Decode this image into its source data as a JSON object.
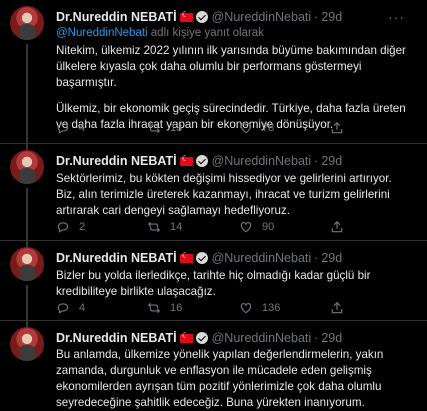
{
  "tweets": [
    {
      "name": "Dr.Nureddin NEBATİ",
      "handle": "@NureddinNebati",
      "time": "29d",
      "reply_to": "@NureddinNebati",
      "reply_suffix": " adlı kişiye yanıt olarak",
      "paragraphs": [
        "Nitekim, ülkemiz 2022 yılının ilk yarısında büyüme bakımından diğer ülkelere kıyasla çok daha olumlu bir performans göstermeyi başarmıştır.",
        "Ülkemiz, bir ekonomik geçiş sürecindedir. Türkiye, daha fazla üreten ve daha fazla ihracat yapan bir ekonomiye dönüşüyor."
      ],
      "replies": "4",
      "retweets": "13",
      "likes": "78"
    },
    {
      "name": "Dr.Nureddin NEBATİ",
      "handle": "@NureddinNebati",
      "time": "29d",
      "paragraphs": [
        "Sektörlerimiz, bu kökten değişimi hissediyor ve gelirlerini artırıyor. Biz, alın terimizle üreterek kazanmayı, ihracat ve turizm gelirlerini artırarak cari dengeyi sağlamayı hedefliyoruz."
      ],
      "replies": "2",
      "retweets": "14",
      "likes": "90"
    },
    {
      "name": "Dr.Nureddin NEBATİ",
      "handle": "@NureddinNebati",
      "time": "29d",
      "paragraphs": [
        "Bizler bu yolda ilerledikçe, tarihte hiç olmadığı kadar güçlü bir kredibiliteye birlikte ulaşacağız."
      ],
      "replies": "4",
      "retweets": "16",
      "likes": "136"
    },
    {
      "name": "Dr.Nureddin NEBATİ",
      "handle": "@NureddinNebati",
      "time": "29d",
      "paragraphs": [
        "Bu anlamda, ülkemize yönelik yapılan değerlendirmelerin, yakın zamanda, durgunluk ve enflasyon ile mücadele eden gelişmiş ekonomilerden ayrışan tüm pozitif yönlerimizle çok daha olumlu seyredeceğine şahitlik edeceğiz. Buna yürekten inanıyorum."
      ]
    }
  ],
  "icons": {
    "reply": "reply-icon",
    "retweet": "retweet-icon",
    "like": "heart-icon",
    "share": "share-icon",
    "verified": "verified-badge-icon",
    "flag": "turkey-flag-icon",
    "more": "more-options-icon"
  }
}
